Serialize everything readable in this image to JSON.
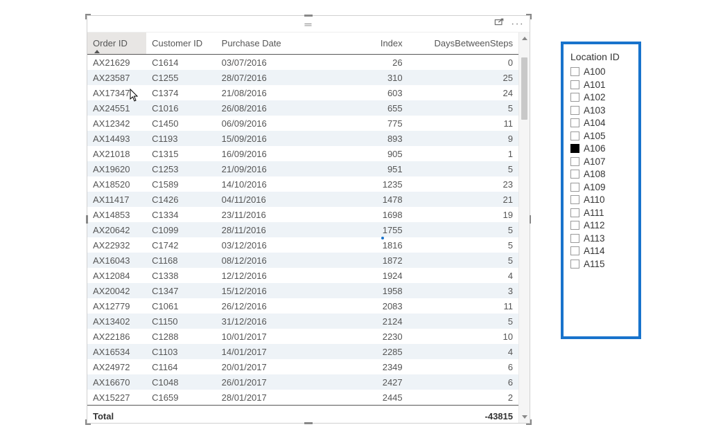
{
  "table": {
    "columns": [
      {
        "key": "order_id",
        "label": "Order ID",
        "align": "left",
        "sorted": true
      },
      {
        "key": "customer_id",
        "label": "Customer ID",
        "align": "left"
      },
      {
        "key": "purchase_date",
        "label": "Purchase Date",
        "align": "left"
      },
      {
        "key": "index",
        "label": "Index",
        "align": "right"
      },
      {
        "key": "days_between_steps",
        "label": "DaysBetweenSteps",
        "align": "right"
      }
    ],
    "rows": [
      {
        "order_id": "AX21629",
        "customer_id": "C1614",
        "purchase_date": "03/07/2016",
        "index": "26",
        "days_between_steps": "0"
      },
      {
        "order_id": "AX23587",
        "customer_id": "C1255",
        "purchase_date": "28/07/2016",
        "index": "310",
        "days_between_steps": "25"
      },
      {
        "order_id": "AX17347",
        "customer_id": "C1374",
        "purchase_date": "21/08/2016",
        "index": "603",
        "days_between_steps": "24"
      },
      {
        "order_id": "AX24551",
        "customer_id": "C1016",
        "purchase_date": "26/08/2016",
        "index": "655",
        "days_between_steps": "5"
      },
      {
        "order_id": "AX12342",
        "customer_id": "C1450",
        "purchase_date": "06/09/2016",
        "index": "775",
        "days_between_steps": "11"
      },
      {
        "order_id": "AX14493",
        "customer_id": "C1193",
        "purchase_date": "15/09/2016",
        "index": "893",
        "days_between_steps": "9"
      },
      {
        "order_id": "AX21018",
        "customer_id": "C1315",
        "purchase_date": "16/09/2016",
        "index": "905",
        "days_between_steps": "1"
      },
      {
        "order_id": "AX19620",
        "customer_id": "C1253",
        "purchase_date": "21/09/2016",
        "index": "951",
        "days_between_steps": "5"
      },
      {
        "order_id": "AX18520",
        "customer_id": "C1589",
        "purchase_date": "14/10/2016",
        "index": "1235",
        "days_between_steps": "23"
      },
      {
        "order_id": "AX11417",
        "customer_id": "C1426",
        "purchase_date": "04/11/2016",
        "index": "1478",
        "days_between_steps": "21"
      },
      {
        "order_id": "AX14853",
        "customer_id": "C1334",
        "purchase_date": "23/11/2016",
        "index": "1698",
        "days_between_steps": "19"
      },
      {
        "order_id": "AX20642",
        "customer_id": "C1099",
        "purchase_date": "28/11/2016",
        "index": "1755",
        "days_between_steps": "5"
      },
      {
        "order_id": "AX22932",
        "customer_id": "C1742",
        "purchase_date": "03/12/2016",
        "index": "1816",
        "days_between_steps": "5"
      },
      {
        "order_id": "AX16043",
        "customer_id": "C1168",
        "purchase_date": "08/12/2016",
        "index": "1872",
        "days_between_steps": "5"
      },
      {
        "order_id": "AX12084",
        "customer_id": "C1338",
        "purchase_date": "12/12/2016",
        "index": "1924",
        "days_between_steps": "4"
      },
      {
        "order_id": "AX20042",
        "customer_id": "C1347",
        "purchase_date": "15/12/2016",
        "index": "1958",
        "days_between_steps": "3"
      },
      {
        "order_id": "AX12779",
        "customer_id": "C1061",
        "purchase_date": "26/12/2016",
        "index": "2083",
        "days_between_steps": "11"
      },
      {
        "order_id": "AX13402",
        "customer_id": "C1150",
        "purchase_date": "31/12/2016",
        "index": "2124",
        "days_between_steps": "5"
      },
      {
        "order_id": "AX22186",
        "customer_id": "C1288",
        "purchase_date": "10/01/2017",
        "index": "2230",
        "days_between_steps": "10"
      },
      {
        "order_id": "AX16534",
        "customer_id": "C1103",
        "purchase_date": "14/01/2017",
        "index": "2285",
        "days_between_steps": "4"
      },
      {
        "order_id": "AX24972",
        "customer_id": "C1164",
        "purchase_date": "20/01/2017",
        "index": "2349",
        "days_between_steps": "6"
      },
      {
        "order_id": "AX16670",
        "customer_id": "C1048",
        "purchase_date": "26/01/2017",
        "index": "2427",
        "days_between_steps": "6"
      },
      {
        "order_id": "AX15227",
        "customer_id": "C1659",
        "purchase_date": "28/01/2017",
        "index": "2445",
        "days_between_steps": "2"
      }
    ],
    "footer": {
      "label": "Total",
      "days_between_steps": "-43815"
    }
  },
  "slicer": {
    "title": "Location ID",
    "items": [
      {
        "label": "A100",
        "selected": false
      },
      {
        "label": "A101",
        "selected": false
      },
      {
        "label": "A102",
        "selected": false
      },
      {
        "label": "A103",
        "selected": false
      },
      {
        "label": "A104",
        "selected": false
      },
      {
        "label": "A105",
        "selected": false
      },
      {
        "label": "A106",
        "selected": true
      },
      {
        "label": "A107",
        "selected": false
      },
      {
        "label": "A108",
        "selected": false
      },
      {
        "label": "A109",
        "selected": false
      },
      {
        "label": "A110",
        "selected": false
      },
      {
        "label": "A111",
        "selected": false
      },
      {
        "label": "A112",
        "selected": false
      },
      {
        "label": "A113",
        "selected": false
      },
      {
        "label": "A114",
        "selected": false
      },
      {
        "label": "A115",
        "selected": false
      }
    ]
  }
}
